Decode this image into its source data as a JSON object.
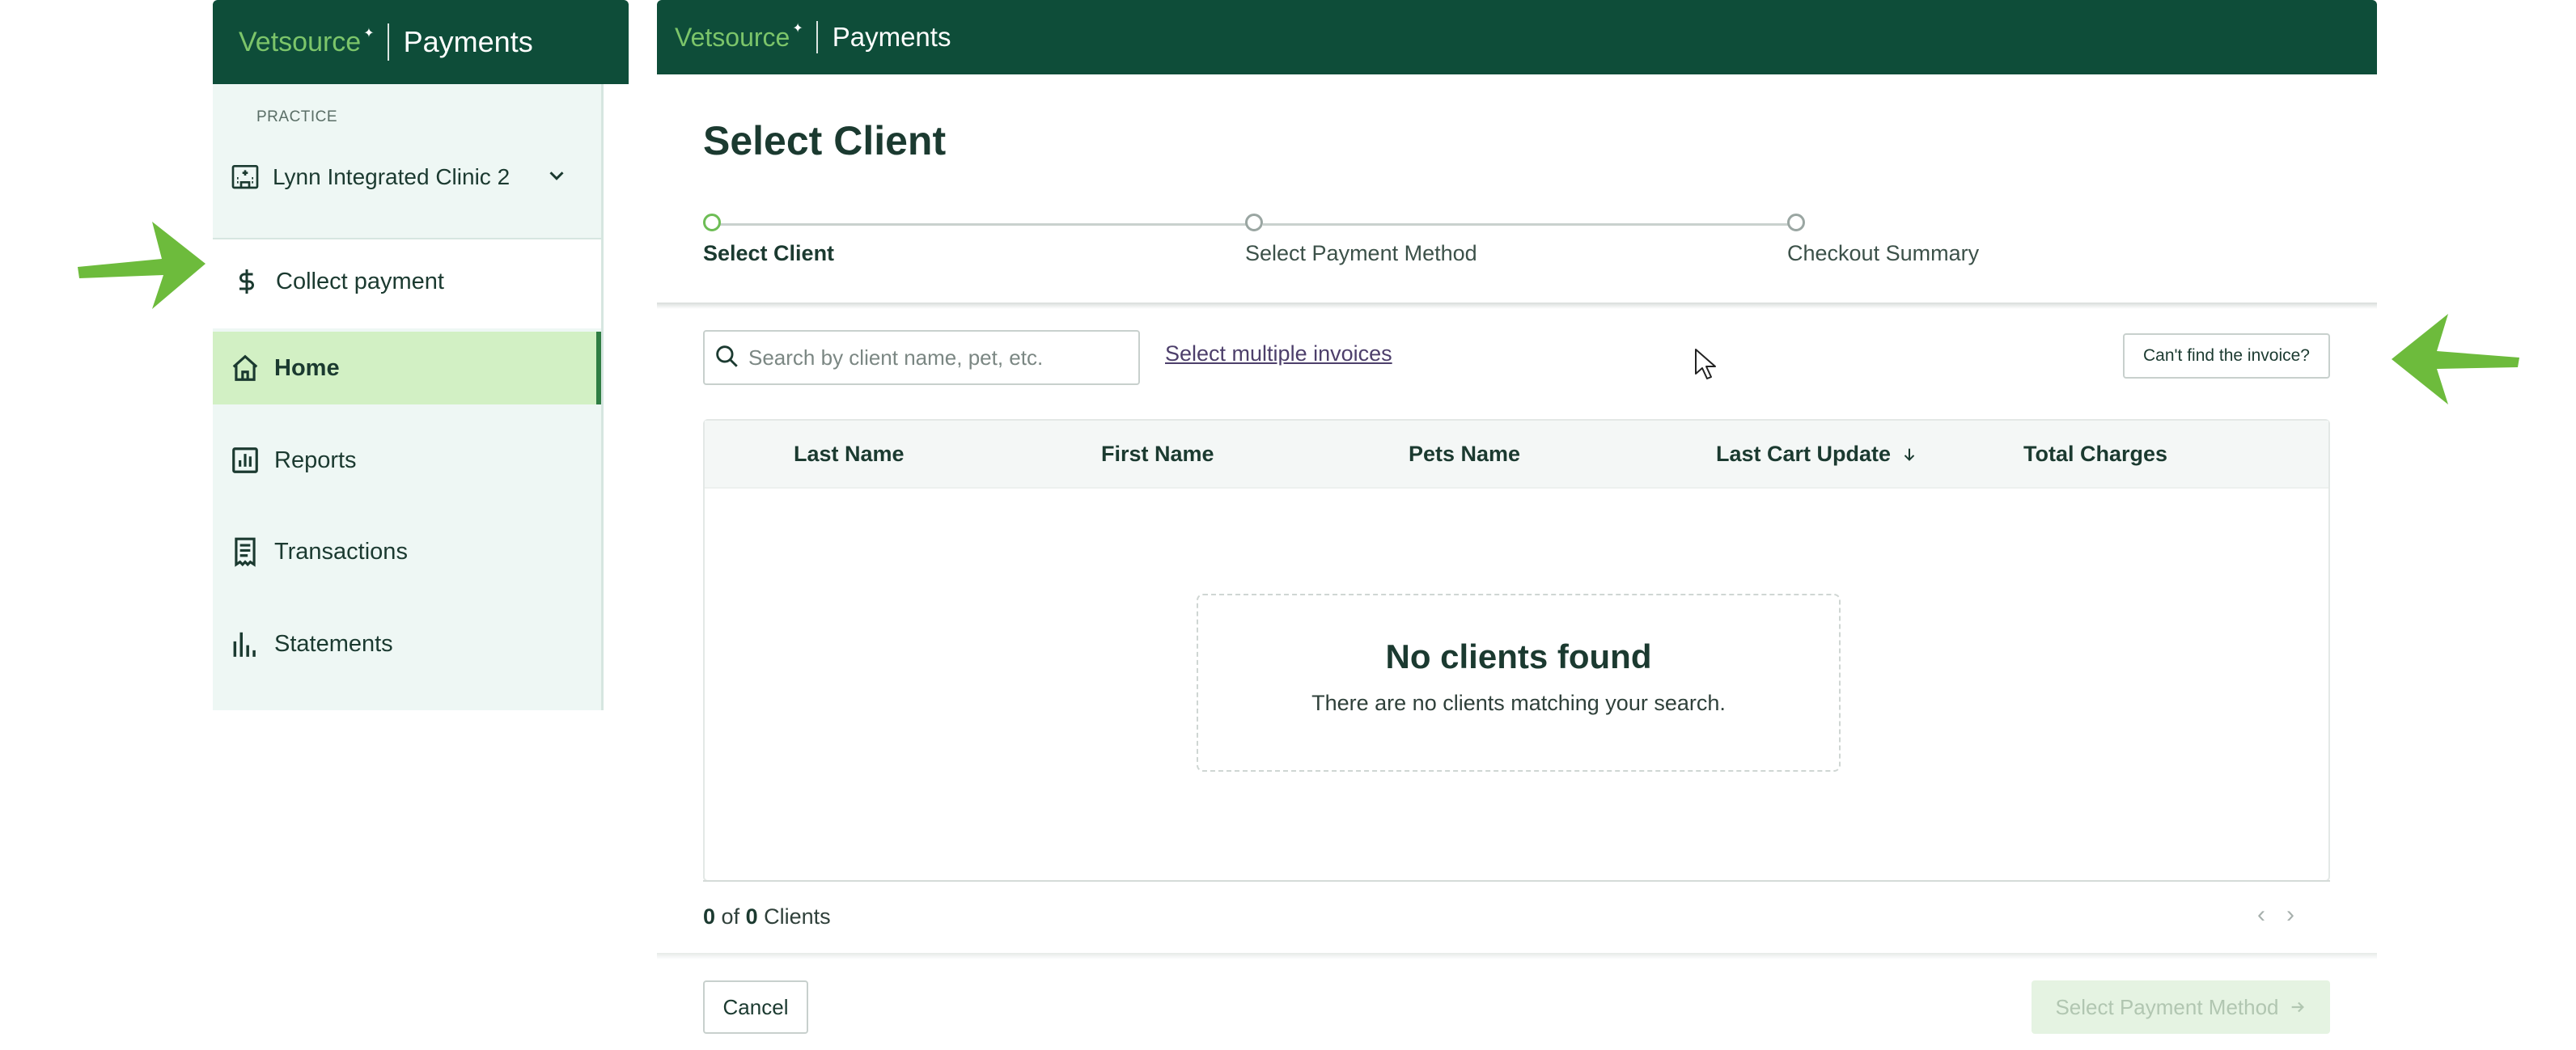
{
  "sidebar": {
    "brand": "Vetsource",
    "product": "Payments",
    "practice_label": "PRACTICE",
    "practice_name": "Lynn Integrated Clinic 2",
    "collect_label": "Collect payment",
    "items": [
      {
        "label": "Home",
        "icon": "home-icon",
        "active": true
      },
      {
        "label": "Reports",
        "icon": "reports-icon"
      },
      {
        "label": "Transactions",
        "icon": "receipt-icon"
      },
      {
        "label": "Statements",
        "icon": "bar-chart-icon"
      }
    ]
  },
  "header": {
    "brand": "Vetsource",
    "product": "Payments"
  },
  "page": {
    "title": "Select Client"
  },
  "stepper": [
    {
      "label": "Select Client",
      "active": true
    },
    {
      "label": "Select Payment Method"
    },
    {
      "label": "Checkout Summary"
    }
  ],
  "toolbar": {
    "search_placeholder": "Search by client name, pet, etc.",
    "multi_link": "Select multiple invoices",
    "cant_find": "Can't find the invoice?"
  },
  "table": {
    "columns": [
      "Last Name",
      "First Name",
      "Pets Name",
      "Last Cart Update",
      "Total Charges"
    ],
    "sorted_column": "Last Cart Update",
    "rows": [],
    "empty_title": "No clients found",
    "empty_sub": "There are no clients matching your search."
  },
  "footer": {
    "shown": "0",
    "of_word": "of",
    "total": "0",
    "unit": "Clients",
    "cancel": "Cancel",
    "next": "Select Payment Method"
  },
  "colors": {
    "header_bg": "#0e4d39",
    "brand_green": "#7cc56a",
    "active_nav_bg": "#d2f0c4",
    "annotation_arrow": "#6dbb3c"
  }
}
